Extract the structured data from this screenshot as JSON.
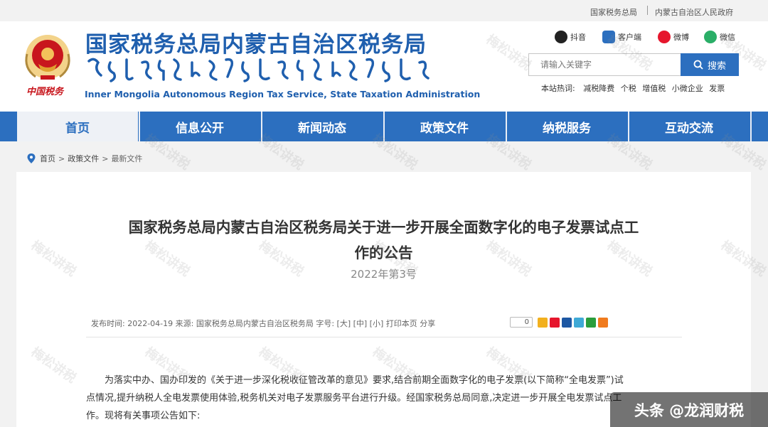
{
  "topbar": {
    "link1": "国家税务总局",
    "link2": "内蒙古自治区人民政府"
  },
  "header": {
    "cn_title": "国家税务总局内蒙古自治区税务局",
    "en_title": "Inner Mongolia Autonomous Region Tax Service, State Taxation Administration",
    "emblem_caption": "中国税务",
    "social": [
      "抖音",
      "客户端",
      "微博",
      "微信"
    ],
    "search_placeholder": "请输入关键字",
    "search_button": "搜索",
    "hot_label": "本站热词:",
    "hot_words": [
      "减税降费",
      "个税",
      "增值税",
      "小微企业",
      "发票"
    ]
  },
  "nav": [
    "首页",
    "信息公开",
    "新闻动态",
    "政策文件",
    "纳税服务",
    "互动交流"
  ],
  "breadcrumb": {
    "home": "首页",
    "level1": "政策文件",
    "level2": "最新文件"
  },
  "article": {
    "title_line1": "国家税务总局内蒙古自治区税务局关于进一步开展全面数字化的电子发票试点工",
    "title_line2": "作的公告",
    "doc_no": "2022年第3号",
    "meta": "发布时间:   2022-04-19   来源:     国家税务总局内蒙古自治区税务局   字号:     [大]   [中]   [小]   打印本页   分享",
    "share_count": "0",
    "body_line1": "为落实中办、国办印发的《关于进一步深化税收征管改革的意见》要求,结合前期全面数字化的电子发票(以下简称“全电发票”)试",
    "body_line2": "点情况,提升纳税人全电发票使用体验,税务机关对电子发票服务平台进行升级。经国家税务总局同意,决定进一步开展全电发票试点工",
    "body_line3": "作。现将有关事项公告如下:"
  },
  "watermark": "梅松讲税",
  "corner_label": "头条 @龙润财税",
  "colors": {
    "brand_blue": "#2c6fbf",
    "title_blue": "#1f5fae",
    "tax_red": "#c8161d"
  },
  "icons": [
    "douyin-icon",
    "app-client-icon",
    "weibo-icon",
    "wechat-icon",
    "search-icon",
    "location-pin-icon",
    "tax-emblem-icon"
  ]
}
